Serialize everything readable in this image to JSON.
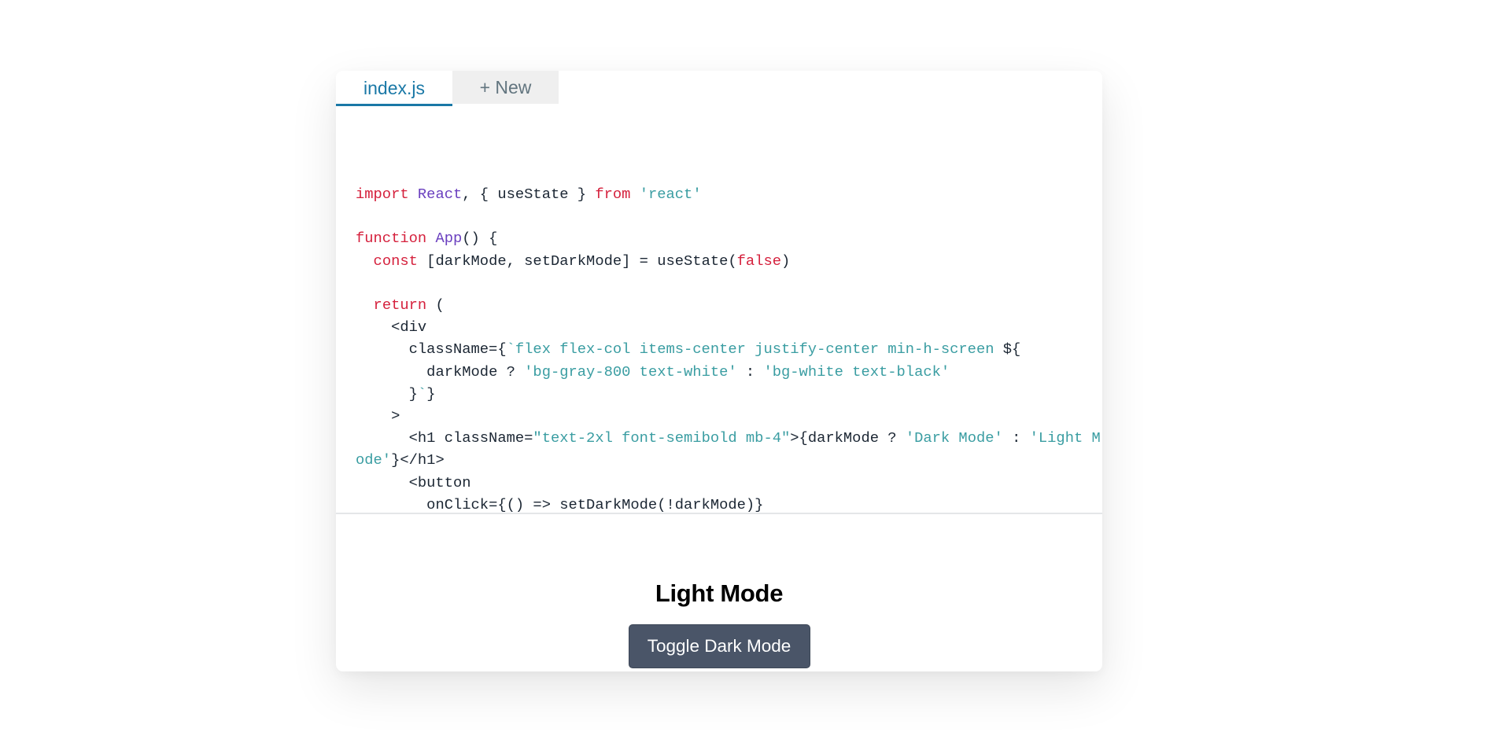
{
  "editor": {
    "tabs": [
      {
        "label": "index.js",
        "active": true
      },
      {
        "label": "+ New",
        "active": false
      }
    ],
    "code_lines": [
      [
        {
          "t": "import",
          "c": "kw"
        },
        {
          "t": " "
        },
        {
          "t": "React",
          "c": "cmp"
        },
        {
          "t": ", { useState } "
        },
        {
          "t": "from",
          "c": "kw"
        },
        {
          "t": " "
        },
        {
          "t": "'react'",
          "c": "str"
        }
      ],
      [],
      [
        {
          "t": "function",
          "c": "kw"
        },
        {
          "t": " "
        },
        {
          "t": "App",
          "c": "cmp"
        },
        {
          "t": "() {"
        }
      ],
      [
        {
          "t": "  "
        },
        {
          "t": "const",
          "c": "kw"
        },
        {
          "t": " [darkMode, setDarkMode] = useState("
        },
        {
          "t": "false",
          "c": "kw"
        },
        {
          "t": ")"
        }
      ],
      [],
      [
        {
          "t": "  "
        },
        {
          "t": "return",
          "c": "kw"
        },
        {
          "t": " ("
        }
      ],
      [
        {
          "t": "    <div"
        }
      ],
      [
        {
          "t": "      className={"
        },
        {
          "t": "`flex flex-col items-center justify-center min-h-screen ",
          "c": "str"
        },
        {
          "t": "${"
        }
      ],
      [
        {
          "t": "        darkMode ? "
        },
        {
          "t": "'bg-gray-800 text-white'",
          "c": "str"
        },
        {
          "t": " : "
        },
        {
          "t": "'bg-white text-black'",
          "c": "str"
        }
      ],
      [
        {
          "t": "      }"
        },
        {
          "t": "`",
          "c": "str"
        },
        {
          "t": "}"
        }
      ],
      [
        {
          "t": "    >"
        }
      ],
      [
        {
          "t": "      <h1 className="
        },
        {
          "t": "\"text-2xl font-semibold mb-4\"",
          "c": "str"
        },
        {
          "t": ">{darkMode ? "
        },
        {
          "t": "'Dark Mode'",
          "c": "str"
        },
        {
          "t": " : "
        },
        {
          "t": "'Light Mode'",
          "c": "str"
        },
        {
          "t": "}</h1>"
        }
      ],
      [
        {
          "t": "      <button"
        }
      ],
      [
        {
          "t": "        onClick={() => setDarkMode(!darkMode)}"
        }
      ]
    ]
  },
  "preview": {
    "title": "Light Mode",
    "button_label": "Toggle Dark Mode"
  },
  "colors": {
    "tab_active": "#1a78a6",
    "keyword": "#d5213d",
    "component": "#6a3fbf",
    "string": "#3a9da2",
    "button_bg": "#4a5568"
  }
}
